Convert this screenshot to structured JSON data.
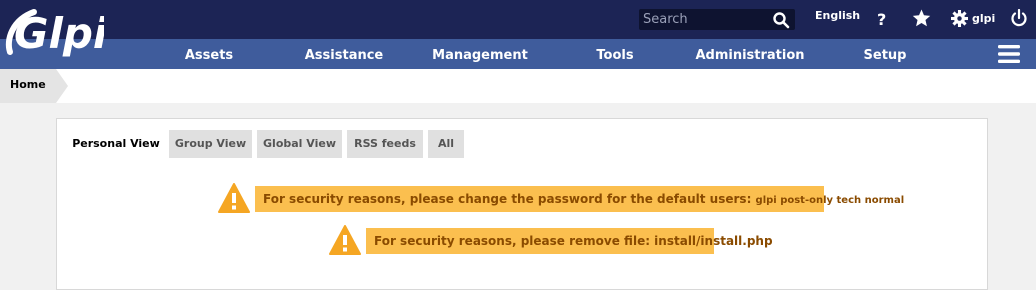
{
  "header": {
    "logo_text": "Glpi",
    "search": {
      "placeholder": "Search"
    },
    "language": "English",
    "help_icon": "question-mark-icon",
    "favorites_icon": "star-icon",
    "user_icon": "gear-icon",
    "user_name": "glpi",
    "logout_icon": "power-icon"
  },
  "nav": {
    "items": [
      "Assets",
      "Assistance",
      "Management",
      "Tools",
      "Administration",
      "Setup"
    ],
    "menu_icon": "hamburger-icon"
  },
  "breadcrumb": {
    "home": "Home"
  },
  "tabs": [
    {
      "label": "Personal View",
      "active": true
    },
    {
      "label": "Group View",
      "active": false
    },
    {
      "label": "Global View",
      "active": false
    },
    {
      "label": "RSS feeds",
      "active": false
    },
    {
      "label": "All",
      "active": false
    }
  ],
  "alerts": [
    {
      "text": "For security reasons, please change the password for the default users: ",
      "users": "glpi post-only tech normal"
    },
    {
      "text": "For security reasons, please remove file: install/install.php"
    }
  ],
  "colors": {
    "topbar": "#1c2455",
    "navbar": "#3f5c9c",
    "alert_bg": "#fbbf4f",
    "alert_text": "#8a4b00",
    "warning_icon": "#f5a623"
  }
}
